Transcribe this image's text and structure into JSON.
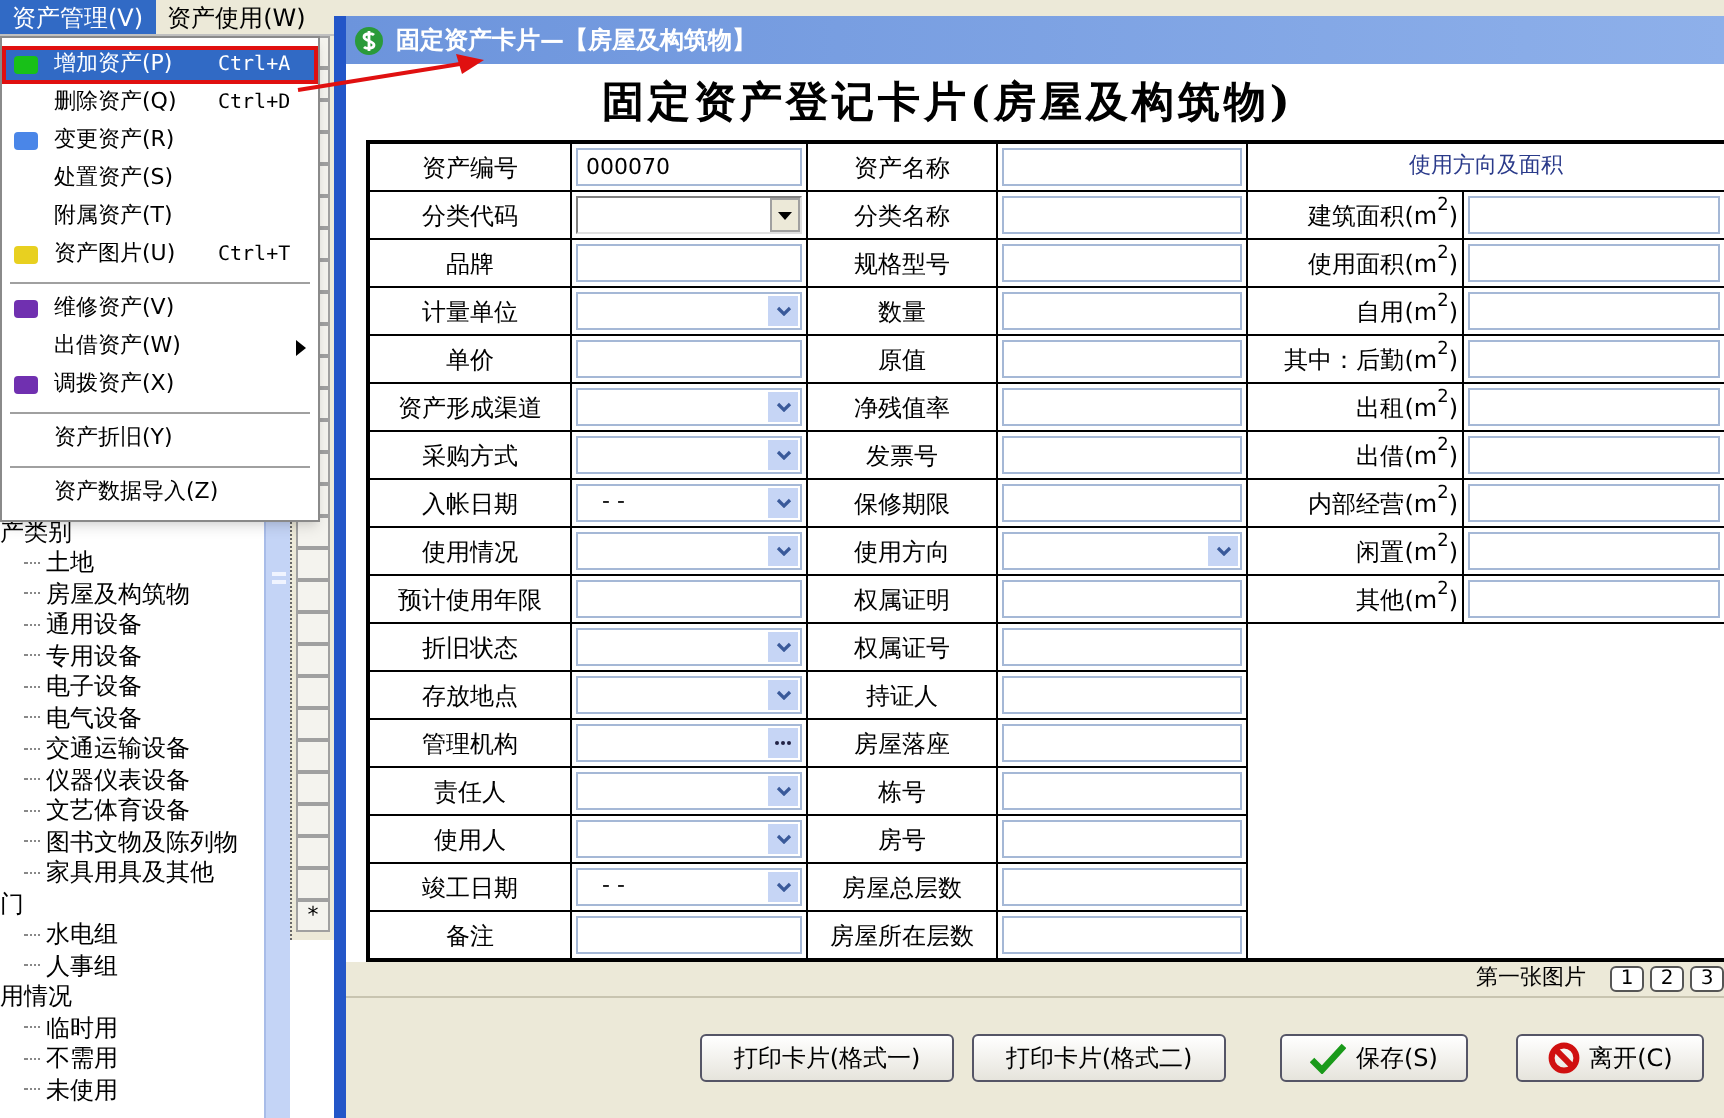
{
  "menubar": [
    {
      "label": "资产管理(V)",
      "selected": true
    },
    {
      "label": "资产使用(W)",
      "selected": false
    }
  ],
  "menu": [
    {
      "kind": "item",
      "label": "增加资产(P)",
      "shortcut": "Ctrl+A",
      "color": "#18c018",
      "selected": true,
      "submenu": false
    },
    {
      "kind": "item",
      "label": "删除资产(Q)",
      "shortcut": "Ctrl+D",
      "selected": false,
      "submenu": false
    },
    {
      "kind": "item",
      "label": "变更资产(R)",
      "color": "#4a86e8",
      "selected": false,
      "submenu": false
    },
    {
      "kind": "item",
      "label": "处置资产(S)",
      "selected": false,
      "submenu": false
    },
    {
      "kind": "item",
      "label": "附属资产(T)",
      "selected": false,
      "submenu": false
    },
    {
      "kind": "item",
      "label": "资产图片(U)",
      "shortcut": "Ctrl+T",
      "color": "#e8d020",
      "selected": false,
      "submenu": false
    },
    {
      "kind": "separator"
    },
    {
      "kind": "item",
      "label": "维修资产(V)",
      "color": "#7030b0",
      "selected": false,
      "submenu": false
    },
    {
      "kind": "item",
      "label": "出借资产(W)",
      "selected": false,
      "submenu": true
    },
    {
      "kind": "item",
      "label": "调拨资产(X)",
      "color": "#7030b0",
      "selected": false,
      "submenu": false
    },
    {
      "kind": "separator"
    },
    {
      "kind": "item",
      "label": "资产折旧(Y)",
      "selected": false,
      "submenu": false
    },
    {
      "kind": "separator"
    },
    {
      "kind": "item",
      "label": "资产数据导入(Z)",
      "selected": false,
      "submenu": false
    }
  ],
  "tree": [
    {
      "label": "产类别",
      "children": [
        {
          "label": "土地"
        },
        {
          "label": "房屋及构筑物"
        },
        {
          "label": "通用设备"
        },
        {
          "label": "专用设备"
        },
        {
          "label": "电子设备"
        },
        {
          "label": "电气设备"
        },
        {
          "label": "交通运输设备"
        },
        {
          "label": "仪器仪表设备"
        },
        {
          "label": "文艺体育设备"
        },
        {
          "label": "图书文物及陈列物"
        },
        {
          "label": "家具用具及其他"
        }
      ]
    },
    {
      "label": "门",
      "children": [
        {
          "label": "水电组"
        },
        {
          "label": "人事组"
        }
      ]
    },
    {
      "label": "用情况",
      "children": [
        {
          "label": "临时用"
        },
        {
          "label": "不需用"
        },
        {
          "label": "未使用"
        }
      ]
    }
  ],
  "grid_marker": "*",
  "window": {
    "title": "固定资产卡片—【房屋及构筑物】"
  },
  "card_title": "固定资产登记卡片(房屋及构筑物)",
  "left_rows": [
    {
      "label": "资产编号",
      "field": {
        "kind": "text",
        "value": "000070"
      }
    },
    {
      "label": "分类代码",
      "field": {
        "kind": "combo"
      }
    },
    {
      "label": "品牌",
      "field": {
        "kind": "text"
      }
    },
    {
      "label": "计量单位",
      "field": {
        "kind": "dropdown"
      }
    },
    {
      "label": "单价",
      "field": {
        "kind": "text"
      }
    },
    {
      "label": "资产形成渠道",
      "field": {
        "kind": "dropdown"
      }
    },
    {
      "label": "采购方式",
      "field": {
        "kind": "dropdown"
      }
    },
    {
      "label": "入帐日期",
      "field": {
        "kind": "dropdown",
        "value": "- -"
      }
    },
    {
      "label": "使用情况",
      "field": {
        "kind": "dropdown"
      }
    },
    {
      "label": "预计使用年限",
      "field": {
        "kind": "text"
      }
    },
    {
      "label": "折旧状态",
      "field": {
        "kind": "dropdown"
      }
    },
    {
      "label": "存放地点",
      "field": {
        "kind": "dropdown"
      }
    },
    {
      "label": "管理机构",
      "field": {
        "kind": "ellipsis"
      }
    },
    {
      "label": "责任人",
      "field": {
        "kind": "dropdown"
      }
    },
    {
      "label": "使用人",
      "field": {
        "kind": "dropdown"
      }
    },
    {
      "label": "竣工日期",
      "field": {
        "kind": "dropdown",
        "value": "- -"
      }
    },
    {
      "label": "备注",
      "field": {
        "kind": "text"
      }
    }
  ],
  "middle_rows": [
    {
      "label": "资产名称",
      "field": {
        "kind": "text"
      }
    },
    {
      "label": "分类名称",
      "field": {
        "kind": "text"
      }
    },
    {
      "label": "规格型号",
      "field": {
        "kind": "text"
      }
    },
    {
      "label": "数量",
      "field": {
        "kind": "text"
      }
    },
    {
      "label": "原值",
      "field": {
        "kind": "text"
      }
    },
    {
      "label": "净残值率",
      "field": {
        "kind": "text"
      }
    },
    {
      "label": "发票号",
      "field": {
        "kind": "text"
      }
    },
    {
      "label": "保修期限",
      "field": {
        "kind": "text"
      }
    },
    {
      "label": "使用方向",
      "field": {
        "kind": "dropdown"
      }
    },
    {
      "label": "权属证明",
      "field": {
        "kind": "text"
      }
    },
    {
      "label": "权属证号",
      "field": {
        "kind": "text"
      }
    },
    {
      "label": "持证人",
      "field": {
        "kind": "text"
      }
    },
    {
      "label": "房屋落座",
      "field": {
        "kind": "text"
      }
    },
    {
      "label": "栋号",
      "field": {
        "kind": "text"
      }
    },
    {
      "label": "房号",
      "field": {
        "kind": "text"
      }
    },
    {
      "label": "房屋总层数",
      "field": {
        "kind": "text"
      }
    },
    {
      "label": "房屋所在层数",
      "field": {
        "kind": "text"
      }
    }
  ],
  "area": {
    "heading": "使用方向及面积",
    "rows": [
      {
        "label": "建筑面积(m$^{2}$)"
      },
      {
        "label": "使用面积(m$^{2}$)"
      },
      {
        "label": "自用(m$^{2}$)"
      },
      {
        "label": "其中：后勤(m$^{2}$)"
      },
      {
        "label": "出租(m$^{2}$)"
      },
      {
        "label": "出借(m$^{2}$)"
      },
      {
        "label": "内部经营(m$^{2}$)"
      },
      {
        "label": "闲置(m$^{2}$)"
      },
      {
        "label": "其他(m$^{2}$)"
      }
    ]
  },
  "picture_label": "第一张图片",
  "picture_pages": [
    "1",
    "2",
    "3"
  ],
  "buttons": [
    {
      "label": "打印卡片(格式一)",
      "kind": "print"
    },
    {
      "label": "打印卡片(格式二)",
      "kind": "print"
    },
    {
      "label": "保存(S)",
      "kind": "save"
    },
    {
      "label": "离开(C)",
      "kind": "exit"
    }
  ]
}
